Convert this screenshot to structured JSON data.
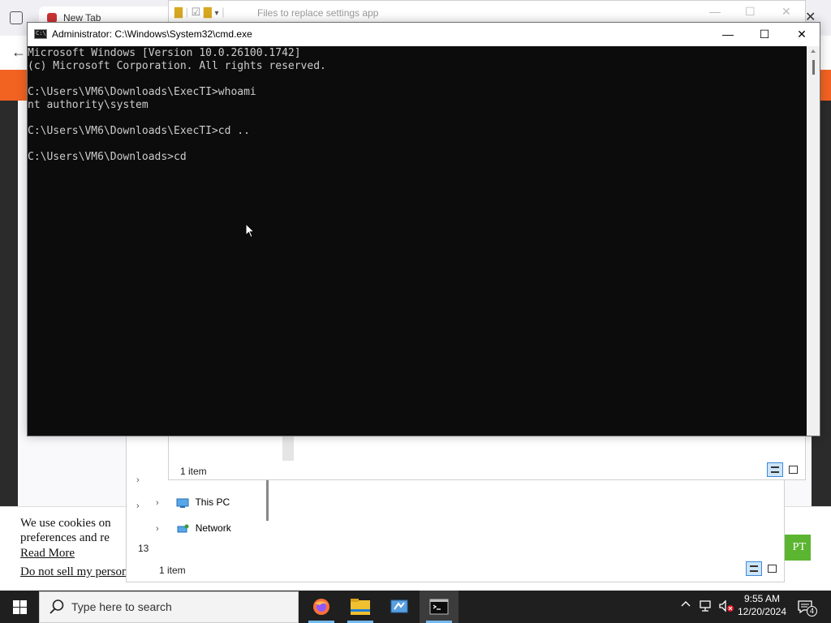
{
  "browser": {
    "tab_title": "New Tab",
    "cookie": {
      "text_line1": "We use cookies on",
      "text_line2": "preferences and re",
      "read_more": "Read More",
      "do_not_sell": "Do not sell my person",
      "accept_label": "PT"
    },
    "orange_bar_color": "#f26322"
  },
  "explorer_back": {
    "nav_items": [
      {
        "label": "This PC",
        "icon": "this-pc-icon"
      },
      {
        "label": "Network",
        "icon": "network-icon"
      }
    ],
    "partial_number": "13",
    "status": "1 item"
  },
  "explorer_front": {
    "title": "Files to replace settings app",
    "status": "1 item"
  },
  "cmd": {
    "title": "Administrator: C:\\Windows\\System32\\cmd.exe",
    "icon_text": "C:\\",
    "lines": [
      "Microsoft Windows [Version 10.0.26100.1742]",
      "(c) Microsoft Corporation. All rights reserved.",
      "",
      "C:\\Users\\VM6\\Downloads\\ExecTI>whoami",
      "nt authority\\system",
      "",
      "C:\\Users\\VM6\\Downloads\\ExecTI>cd ..",
      "",
      "C:\\Users\\VM6\\Downloads>cd"
    ]
  },
  "taskbar": {
    "search_placeholder": "Type here to search",
    "apps": [
      {
        "name": "firefox-icon"
      },
      {
        "name": "file-explorer-icon"
      },
      {
        "name": "control-panel-icon"
      },
      {
        "name": "cmd-icon",
        "active": true
      }
    ],
    "time": "9:55 AM",
    "date": "12/20/2024",
    "notification_count": "4"
  }
}
